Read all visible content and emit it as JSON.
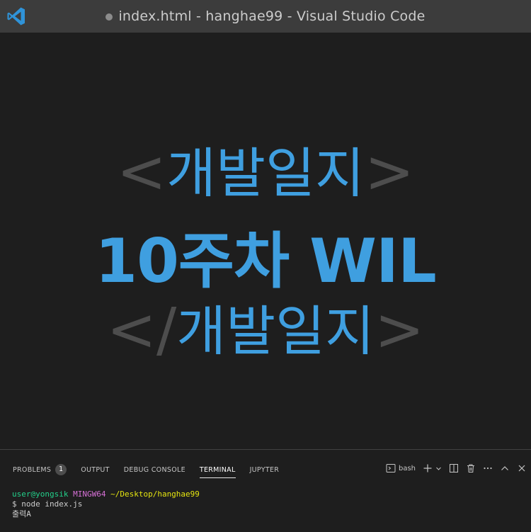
{
  "window": {
    "title": "index.html - hanghae99 - Visual Studio Code",
    "unsaved": true
  },
  "editor": {
    "line1_open_bracket": "<",
    "line1_text": "개발일지",
    "line1_close_bracket": ">",
    "line2_text": "10주차 WIL",
    "line3_open_bracket": "</",
    "line3_text": "개발일지",
    "line3_close_bracket": ">"
  },
  "panel": {
    "tabs": [
      {
        "label": "PROBLEMS",
        "badge": "1"
      },
      {
        "label": "OUTPUT"
      },
      {
        "label": "DEBUG CONSOLE"
      },
      {
        "label": "TERMINAL",
        "active": true
      },
      {
        "label": "JUPYTER"
      }
    ],
    "shell_label": "bash"
  },
  "terminal": {
    "prompt_user": "user@yongsik",
    "prompt_host": "MINGW64",
    "prompt_path": "~/Desktop/hanghae99",
    "command": "$ node index.js",
    "output": "출력A"
  },
  "colors": {
    "accent": "#3f9fe0",
    "bracket": "#4d4d4d",
    "titlebar": "#3c3c3c",
    "background": "#1e1e1e"
  }
}
